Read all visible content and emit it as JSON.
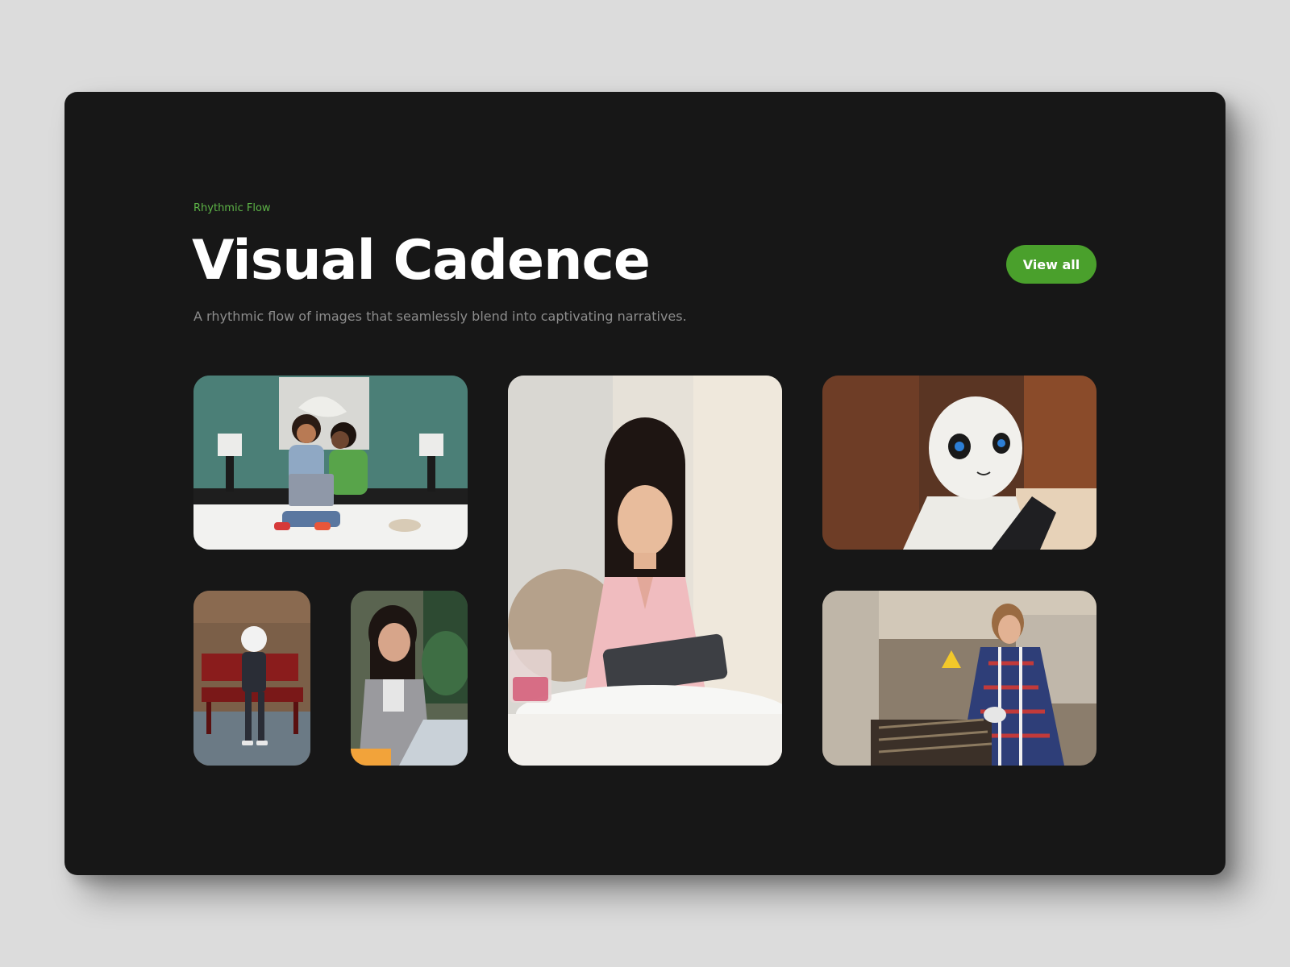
{
  "header": {
    "eyebrow": "Rhythmic Flow",
    "title": "Visual Cadence",
    "subtitle": "A rhythmic flow of images that seamlessly blend into captivating narratives.",
    "view_all_label": "View all"
  },
  "colors": {
    "page_background": "#dcdcdc",
    "card_background": "#171717",
    "accent": "#4aa02c",
    "eyebrow_text": "#5db447",
    "title_text": "#ffffff",
    "subtitle_text": "#8c8c8c"
  }
}
